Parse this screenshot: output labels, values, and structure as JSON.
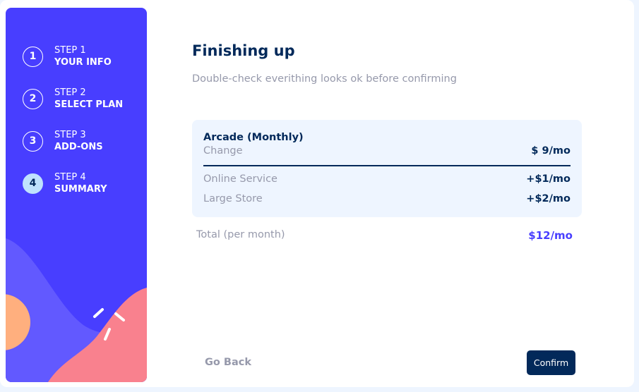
{
  "sidebar": {
    "steps": [
      {
        "number": "1",
        "step": "STEP 1",
        "label": "YOUR INFO"
      },
      {
        "number": "2",
        "step": "STEP 2",
        "label": "SELECT PLAN"
      },
      {
        "number": "3",
        "step": "STEP 3",
        "label": "ADD-ONS"
      },
      {
        "number": "4",
        "step": "STEP 4",
        "label": "SUMMARY"
      }
    ],
    "active_step": 4,
    "colors": {
      "background": "#483eff",
      "active_circle": "#bfe2fd",
      "blob_pink": "#f9818e",
      "blob_orange": "#ffaf7e",
      "blob_purple": "#6259ff"
    }
  },
  "main": {
    "title": "Finishing up",
    "subtitle": "Double-check everithing looks ok before confirming",
    "summary": {
      "plan_name": "Arcade (Monthly)",
      "change_label": "Change",
      "plan_price": "$ 9/mo",
      "addons": [
        {
          "name": "Online Service",
          "price": "+$1/mo"
        },
        {
          "name": "Large Store",
          "price": "+$2/mo"
        }
      ]
    },
    "total": {
      "label": "Total (per month)",
      "value": "$12/mo"
    },
    "buttons": {
      "back": "Go Back",
      "confirm": "Confirm"
    }
  },
  "colors": {
    "marine_blue": "#02295a",
    "purplish_blue": "#483eff",
    "cool_gray": "#9699ab",
    "magnolia": "#eef5ff"
  }
}
